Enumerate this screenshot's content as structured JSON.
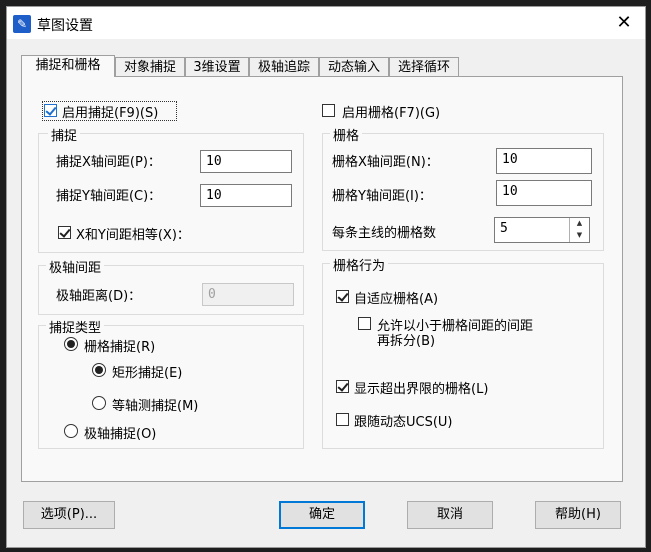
{
  "window": {
    "title": "草图设置",
    "app_icon": "pencil-app-icon",
    "close_glyph": "✕"
  },
  "tabs": [
    {
      "label": "捕捉和栅格",
      "active": true
    },
    {
      "label": "对象捕捉",
      "active": false
    },
    {
      "label": "3维设置",
      "active": false
    },
    {
      "label": "极轴追踪",
      "active": false
    },
    {
      "label": "动态输入",
      "active": false
    },
    {
      "label": "选择循环",
      "active": false
    }
  ],
  "snap": {
    "enable_label": "启用捕捉(F9)(S)",
    "enable_checked": true,
    "group_title": "捕捉",
    "x_spacing_label": "捕捉X轴间距(P)：",
    "x_spacing_value": "10",
    "y_spacing_label": "捕捉Y轴间距(C)：",
    "y_spacing_value": "10",
    "equal_label": "X和Y间距相等(X)：",
    "equal_checked": true
  },
  "polar": {
    "group_title": "极轴间距",
    "distance_label": "极轴距离(D)：",
    "distance_value": "0"
  },
  "snap_type": {
    "group_title": "捕捉类型",
    "grid_snap_label": "栅格捕捉(R)",
    "grid_snap_selected": true,
    "rect_snap_label": "矩形捕捉(E)",
    "rect_snap_selected": true,
    "iso_snap_label": "等轴测捕捉(M)",
    "iso_snap_selected": false,
    "polar_snap_label": "极轴捕捉(O)",
    "polar_snap_selected": false
  },
  "grid": {
    "enable_label": "启用栅格(F7)(G)",
    "enable_checked": false,
    "group_title": "栅格",
    "x_spacing_label": "栅格X轴间距(N)：",
    "x_spacing_value": "10",
    "y_spacing_label": "栅格Y轴间距(I)：",
    "y_spacing_value": "10",
    "major_label": "每条主线的栅格数",
    "major_value": "5"
  },
  "grid_behavior": {
    "group_title": "栅格行为",
    "adaptive_label": "自适应栅格(A)",
    "adaptive_checked": true,
    "subdivide_label_line1": "允许以小于栅格间距的间距",
    "subdivide_label_line2": "再拆分(B)",
    "subdivide_checked": false,
    "beyond_limits_label": "显示超出界限的栅格(L)",
    "beyond_limits_checked": true,
    "follow_ucs_label": "跟随动态UCS(U)",
    "follow_ucs_checked": false
  },
  "buttons": {
    "options": "选项(P)...",
    "ok": "确定",
    "cancel": "取消",
    "help": "帮助(H)"
  }
}
